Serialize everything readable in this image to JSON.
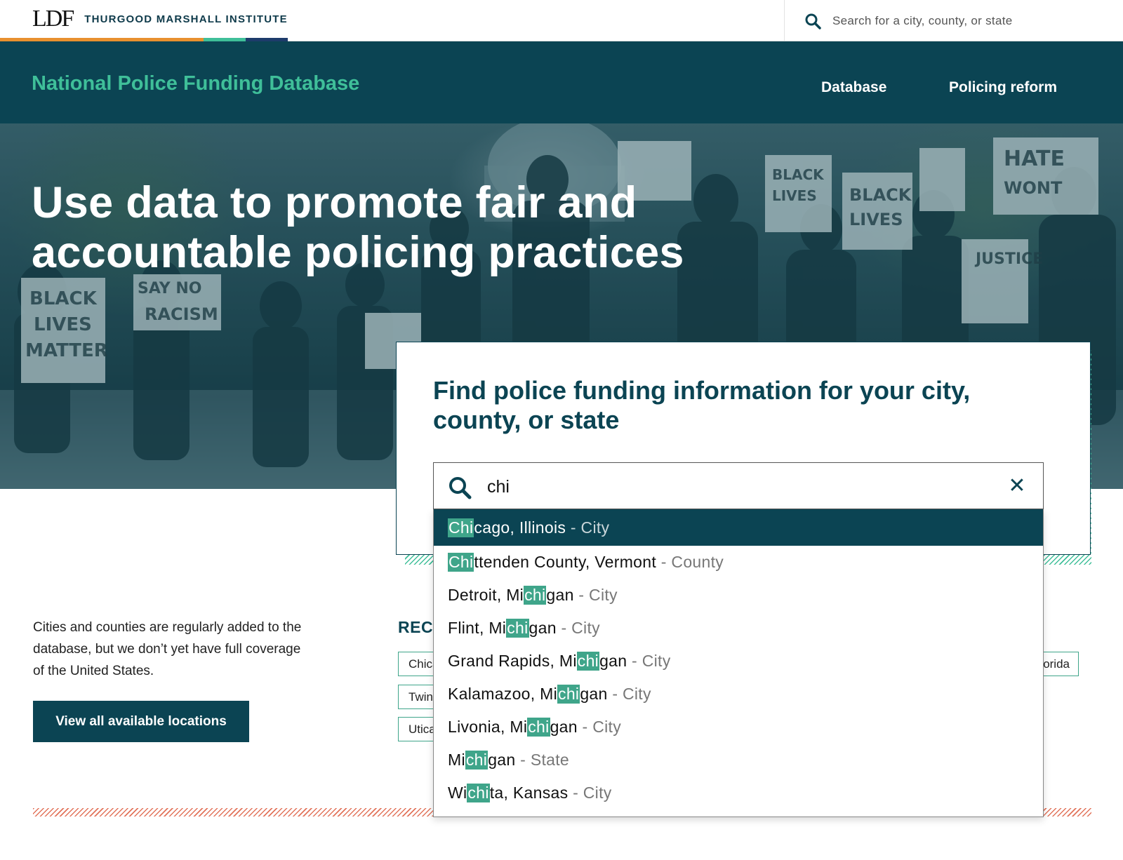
{
  "brand": {
    "logo_mark": "LDF",
    "org_name": "THURGOOD MARSHALL INSTITUTE",
    "stripe_colors": [
      "#e8902f",
      "#3fbf99",
      "#1d3b6b"
    ]
  },
  "top_search": {
    "placeholder": "Search for a city, county, or state",
    "icon": "search-icon"
  },
  "nav": {
    "site_title": "National Police Funding Database",
    "links": [
      {
        "label": "Database"
      },
      {
        "label": "Policing reform"
      }
    ]
  },
  "hero": {
    "title": "Use data to promote fair and accountable policing practices"
  },
  "finder": {
    "title": "Find police funding information for your city, county, or state",
    "query": "chi",
    "clear_icon": "close-icon",
    "results": [
      {
        "pre": "",
        "match": "Chi",
        "post": "cago, Illinois",
        "type": "City",
        "active": true
      },
      {
        "pre": "",
        "match": "Chi",
        "post": "ttenden County, Vermont",
        "type": "County",
        "active": false
      },
      {
        "pre": "Detroit, Mi",
        "match": "chi",
        "post": "gan",
        "type": "City",
        "active": false
      },
      {
        "pre": "Flint, Mi",
        "match": "chi",
        "post": "gan",
        "type": "City",
        "active": false
      },
      {
        "pre": "Grand Rapids, Mi",
        "match": "chi",
        "post": "gan",
        "type": "City",
        "active": false
      },
      {
        "pre": "Kalamazoo, Mi",
        "match": "chi",
        "post": "gan",
        "type": "City",
        "active": false
      },
      {
        "pre": "Livonia, Mi",
        "match": "chi",
        "post": "gan",
        "type": "City",
        "active": false
      },
      {
        "pre": "Mi",
        "match": "chi",
        "post": "gan",
        "type": "State",
        "active": false
      },
      {
        "pre": "Wi",
        "match": "chi",
        "post": "ta, Kansas",
        "type": "City",
        "active": false
      }
    ]
  },
  "coverage": {
    "text": "Cities and counties are regularly added to the database, but we don’t yet have full coverage of the United States.",
    "button_label": "View all available locations"
  },
  "recent": {
    "label": "RECE",
    "chips": [
      "Chica",
      "Twin",
      "Utica",
      "orida"
    ]
  },
  "colors": {
    "primary": "#0b4453",
    "accent": "#3fbf99",
    "highlight": "#3fa58a",
    "divider": "#e2735a"
  }
}
